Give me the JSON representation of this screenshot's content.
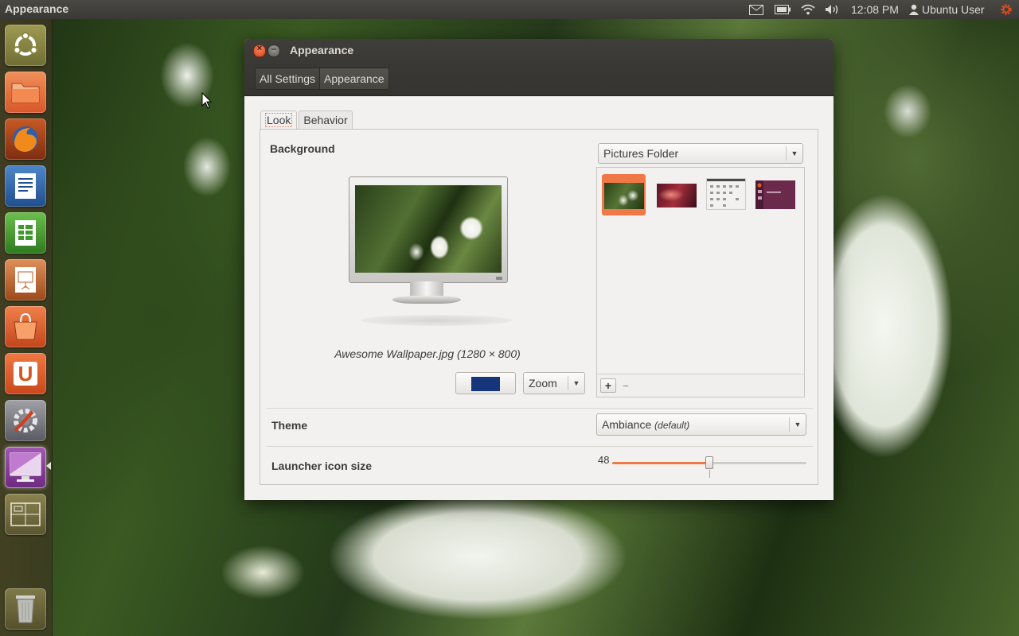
{
  "top_panel": {
    "app_title": "Appearance",
    "time": "12:08 PM",
    "user": "Ubuntu User",
    "indicators": [
      "mail-icon",
      "battery-icon",
      "wifi-icon",
      "volume-icon",
      "session-gear-icon"
    ]
  },
  "launcher": {
    "items": [
      "ubuntu-logo-icon",
      "files-icon",
      "firefox-icon",
      "writer-icon",
      "calc-icon",
      "impress-icon",
      "software-center-icon",
      "ubuntu-one-icon",
      "system-settings-icon",
      "appearance-icon",
      "workspace-switcher-icon",
      "trash-icon"
    ]
  },
  "window": {
    "title": "Appearance",
    "breadcrumbs": [
      "All Settings",
      "Appearance"
    ],
    "tabs": [
      "Look",
      "Behavior"
    ],
    "background_label": "Background",
    "source_combo": "Pictures Folder",
    "wallpaper_caption": "Awesome Wallpaper.jpg (1280 × 800)",
    "color_swatch": "#17357a",
    "placement_combo": "Zoom",
    "add_button": "+",
    "remove_button": "−",
    "theme_label": "Theme",
    "theme_value": "Ambiance",
    "theme_default_note": "(default)",
    "launcher_label": "Launcher icon size",
    "launcher_size": "48",
    "launcher_size_fraction": 0.5
  },
  "colors": {
    "accent": "#f07746",
    "panel_bg": "#3a3935",
    "window_bg": "#f2f1f0"
  }
}
